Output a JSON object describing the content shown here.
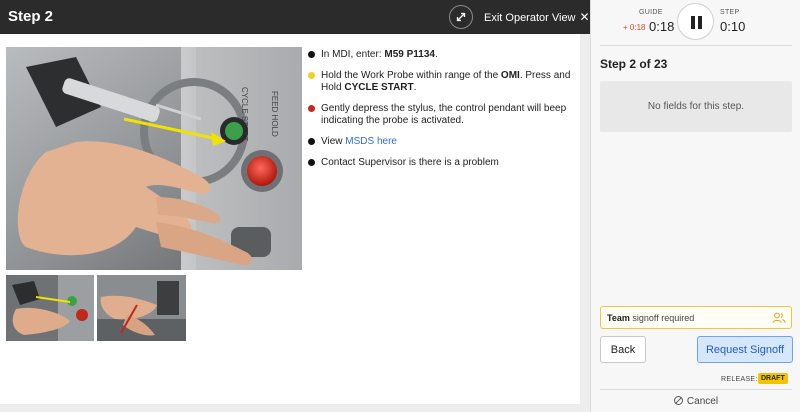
{
  "header": {
    "step_title": "Step 2",
    "exit_label": "Exit Operator View",
    "exit_icon": "close-icon",
    "expand_icon": "expand-icon"
  },
  "instructions": [
    {
      "color": "#111111",
      "parts": [
        {
          "t": "In MDI, enter: "
        },
        {
          "t": "M59 P1134",
          "b": true
        },
        {
          "t": "."
        }
      ]
    },
    {
      "color": "#f0d21a",
      "parts": [
        {
          "t": "Hold the Work Probe within range of the "
        },
        {
          "t": "OMI",
          "b": true
        },
        {
          "t": ". Press and Hold "
        },
        {
          "t": "CYCLE START",
          "b": true
        },
        {
          "t": "."
        }
      ]
    },
    {
      "color": "#c8281e",
      "parts": [
        {
          "t": "Gently depress the stylus, the control pendant will beep indicating the probe is activated."
        }
      ]
    },
    {
      "color": "#111111",
      "parts": [
        {
          "t": "View "
        },
        {
          "t": "MSDS here",
          "link": true
        }
      ]
    },
    {
      "color": "#111111",
      "parts": [
        {
          "t": "Contact Supervisor is there is a problem"
        }
      ]
    }
  ],
  "timer": {
    "guide_label": "GUIDE",
    "guide_delta": "+ 0:18",
    "guide_time": "0:18",
    "step_label": "STEP",
    "step_time": "0:10",
    "pause_icon": "pause-icon"
  },
  "panel": {
    "step_counter": "Step 2 of 23",
    "no_fields": "No fields for this step.",
    "signoff_bold": "Team",
    "signoff_rest": " signoff required",
    "back_label": "Back",
    "request_label": "Request Signoff",
    "release_label": "RELEASE:",
    "release_badge": "DRAFT",
    "cancel_label": "Cancel"
  },
  "colors": {
    "accent_blue": "#2c6fd6",
    "draft_yellow": "#f5c400",
    "delta_red": "#e0442b"
  }
}
